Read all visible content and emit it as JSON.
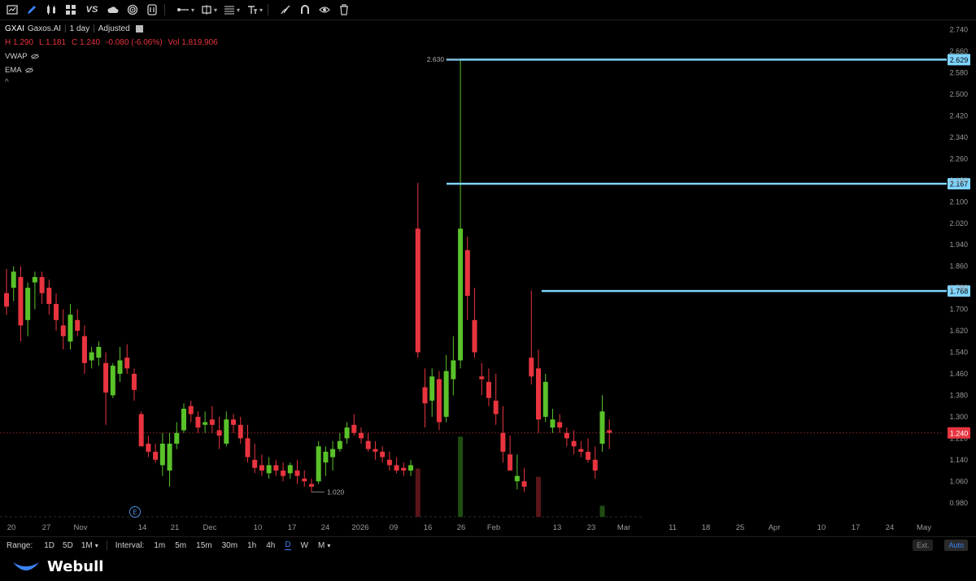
{
  "toolbar": {
    "icons": [
      "chart-type-icon",
      "draw-pen-icon",
      "candles-icon",
      "layout-grid-icon",
      "compare-vs-icon",
      "cloud-icon",
      "target-icon",
      "indicator-icon",
      "line-tool-icon",
      "rect-tool-icon",
      "fib-tool-icon",
      "text-tool-icon",
      "brush-icon",
      "magnet-icon",
      "eye-icon",
      "trash-icon"
    ],
    "compare_label": "VS"
  },
  "symbol": {
    "ticker": "GXAI",
    "name": "Gaxos.AI",
    "period": "1 day",
    "adjust": "Adjusted"
  },
  "ohlc": {
    "high": "H  1.290",
    "low": "L  1.181",
    "close": "C  1.240",
    "change": "-0.080 (-6.06%)",
    "volume": "Vol  1,819,906"
  },
  "indicators": [
    "VWAP",
    "EMA"
  ],
  "collapse_glyph": "^",
  "chart_data": {
    "type": "candlestick",
    "ylim": [
      0.94,
      2.76
    ],
    "y_ticks": [
      "2.740",
      "2.660",
      "2.580",
      "2.500",
      "2.420",
      "2.340",
      "2.260",
      "2.180",
      "2.100",
      "2.020",
      "1.940",
      "1.860",
      "1.780",
      "1.700",
      "1.620",
      "1.540",
      "1.460",
      "1.380",
      "1.300",
      "1.220",
      "1.140",
      "1.060",
      "0.980"
    ],
    "x_ticks": [
      "20",
      "27",
      "Nov",
      "14",
      "21",
      "Dec",
      "10",
      "17",
      "24",
      "2026",
      "09",
      "16",
      "26",
      "Feb",
      "13",
      "23",
      "Mar",
      "11",
      "18",
      "25",
      "Apr",
      "10",
      "17",
      "24",
      "May"
    ],
    "candles": [
      [
        1.76,
        1.85,
        1.68,
        1.71
      ],
      [
        1.78,
        1.86,
        1.73,
        1.84
      ],
      [
        1.82,
        1.86,
        1.58,
        1.64
      ],
      [
        1.66,
        1.8,
        1.6,
        1.78
      ],
      [
        1.8,
        1.84,
        1.7,
        1.82
      ],
      [
        1.82,
        1.84,
        1.72,
        1.76
      ],
      [
        1.78,
        1.81,
        1.68,
        1.72
      ],
      [
        1.72,
        1.76,
        1.62,
        1.66
      ],
      [
        1.64,
        1.7,
        1.55,
        1.6
      ],
      [
        1.58,
        1.72,
        1.55,
        1.68
      ],
      [
        1.66,
        1.7,
        1.6,
        1.62
      ],
      [
        1.6,
        1.64,
        1.46,
        1.5
      ],
      [
        1.51,
        1.56,
        1.48,
        1.54
      ],
      [
        1.52,
        1.58,
        1.49,
        1.56
      ],
      [
        1.5,
        1.54,
        1.27,
        1.39
      ],
      [
        1.38,
        1.5,
        1.37,
        1.49
      ],
      [
        1.46,
        1.56,
        1.43,
        1.51
      ],
      [
        1.52,
        1.57,
        1.46,
        1.48
      ],
      [
        1.46,
        1.48,
        1.36,
        1.4
      ],
      [
        1.31,
        1.32,
        1.2,
        1.19
      ],
      [
        1.2,
        1.23,
        1.15,
        1.17
      ],
      [
        1.17,
        1.2,
        1.13,
        1.14
      ],
      [
        1.12,
        1.24,
        1.08,
        1.2
      ],
      [
        1.1,
        1.24,
        1.04,
        1.2
      ],
      [
        1.2,
        1.28,
        1.18,
        1.24
      ],
      [
        1.25,
        1.35,
        1.24,
        1.33
      ],
      [
        1.34,
        1.36,
        1.28,
        1.31
      ],
      [
        1.3,
        1.32,
        1.24,
        1.26
      ],
      [
        1.27,
        1.32,
        1.24,
        1.28
      ],
      [
        1.29,
        1.34,
        1.24,
        1.27
      ],
      [
        1.25,
        1.3,
        1.18,
        1.23
      ],
      [
        1.2,
        1.32,
        1.19,
        1.29
      ],
      [
        1.29,
        1.31,
        1.24,
        1.27
      ],
      [
        1.27,
        1.3,
        1.2,
        1.22
      ],
      [
        1.22,
        1.27,
        1.13,
        1.15
      ],
      [
        1.14,
        1.2,
        1.09,
        1.11
      ],
      [
        1.12,
        1.16,
        1.08,
        1.1
      ],
      [
        1.09,
        1.15,
        1.07,
        1.12
      ],
      [
        1.12,
        1.14,
        1.08,
        1.1
      ],
      [
        1.1,
        1.13,
        1.06,
        1.08
      ],
      [
        1.09,
        1.13,
        1.07,
        1.12
      ],
      [
        1.1,
        1.14,
        1.05,
        1.08
      ],
      [
        1.07,
        1.1,
        1.04,
        1.06
      ],
      [
        1.05,
        1.07,
        1.02,
        1.04
      ],
      [
        1.06,
        1.21,
        1.05,
        1.19
      ],
      [
        1.13,
        1.19,
        1.08,
        1.17
      ],
      [
        1.15,
        1.21,
        1.1,
        1.18
      ],
      [
        1.18,
        1.24,
        1.17,
        1.21
      ],
      [
        1.22,
        1.28,
        1.2,
        1.26
      ],
      [
        1.27,
        1.31,
        1.23,
        1.24
      ],
      [
        1.24,
        1.26,
        1.2,
        1.22
      ],
      [
        1.21,
        1.24,
        1.17,
        1.18
      ],
      [
        1.18,
        1.21,
        1.14,
        1.17
      ],
      [
        1.17,
        1.19,
        1.13,
        1.15
      ],
      [
        1.14,
        1.17,
        1.1,
        1.12
      ],
      [
        1.12,
        1.15,
        1.09,
        1.1
      ],
      [
        1.11,
        1.13,
        1.08,
        1.1
      ],
      [
        1.1,
        1.14,
        1.08,
        1.12
      ],
      [
        2.0,
        2.17,
        1.52,
        1.54
      ],
      [
        1.41,
        1.48,
        1.26,
        1.35
      ],
      [
        1.36,
        1.48,
        1.3,
        1.45
      ],
      [
        1.44,
        1.47,
        1.25,
        1.28
      ],
      [
        1.3,
        1.53,
        1.28,
        1.47
      ],
      [
        1.44,
        1.6,
        1.38,
        1.51
      ],
      [
        1.51,
        2.63,
        1.48,
        2.0
      ],
      [
        1.92,
        1.97,
        1.66,
        1.75
      ],
      [
        1.66,
        1.78,
        1.52,
        1.54
      ],
      [
        1.45,
        1.5,
        1.38,
        1.44
      ],
      [
        1.43,
        1.48,
        1.34,
        1.37
      ],
      [
        1.36,
        1.46,
        1.27,
        1.31
      ],
      [
        1.24,
        1.34,
        1.13,
        1.17
      ],
      [
        1.16,
        1.23,
        1.1,
        1.1
      ],
      [
        1.06,
        1.16,
        1.03,
        1.08
      ],
      [
        1.06,
        1.11,
        1.02,
        1.04
      ],
      [
        1.52,
        1.77,
        1.42,
        1.45
      ],
      [
        1.48,
        1.55,
        1.24,
        1.29
      ],
      [
        1.3,
        1.46,
        1.28,
        1.43
      ],
      [
        1.26,
        1.33,
        1.24,
        1.29
      ],
      [
        1.28,
        1.31,
        1.24,
        1.26
      ],
      [
        1.24,
        1.26,
        1.19,
        1.22
      ],
      [
        1.21,
        1.25,
        1.16,
        1.19
      ],
      [
        1.18,
        1.21,
        1.15,
        1.17
      ],
      [
        1.17,
        1.22,
        1.13,
        1.14
      ],
      [
        1.14,
        1.19,
        1.07,
        1.1
      ],
      [
        1.2,
        1.38,
        1.17,
        1.32
      ],
      [
        1.25,
        1.29,
        1.18,
        1.24
      ]
    ],
    "volume_spikes": [
      {
        "index": 58,
        "color": "red",
        "value": 0.35
      },
      {
        "index": 64,
        "color": "green",
        "value": 0.58
      },
      {
        "index": 75,
        "color": "red",
        "value": 0.29
      },
      {
        "index": 84,
        "color": "green",
        "value": 0.08
      }
    ],
    "horizontal_levels": [
      {
        "value": 2.629,
        "label": "2.629"
      },
      {
        "value": 2.167,
        "label": "2.167"
      },
      {
        "value": 1.768,
        "label": "1.768"
      }
    ],
    "last_price": {
      "value": 1.24,
      "label": "1.240"
    },
    "high_marker": {
      "value": 2.63,
      "label": "2.630"
    },
    "low_marker": {
      "value": 1.02,
      "label": "1.020"
    },
    "earnings_marker": "E"
  },
  "bottombar": {
    "range_label": "Range:",
    "ranges": [
      "1D",
      "5D",
      "1M"
    ],
    "interval_label": "Interval:",
    "intervals": [
      "1m",
      "5m",
      "15m",
      "30m",
      "1h",
      "4h",
      "D",
      "W",
      "M"
    ],
    "active_interval": "D",
    "ext_label": "Ext.",
    "auto_label": "Auto"
  },
  "colors": {
    "up": "#59c229",
    "down": "#e8343f",
    "level": "#7fd4ff",
    "grid": "#1a1a1a"
  },
  "brand": {
    "name": "Webull"
  }
}
